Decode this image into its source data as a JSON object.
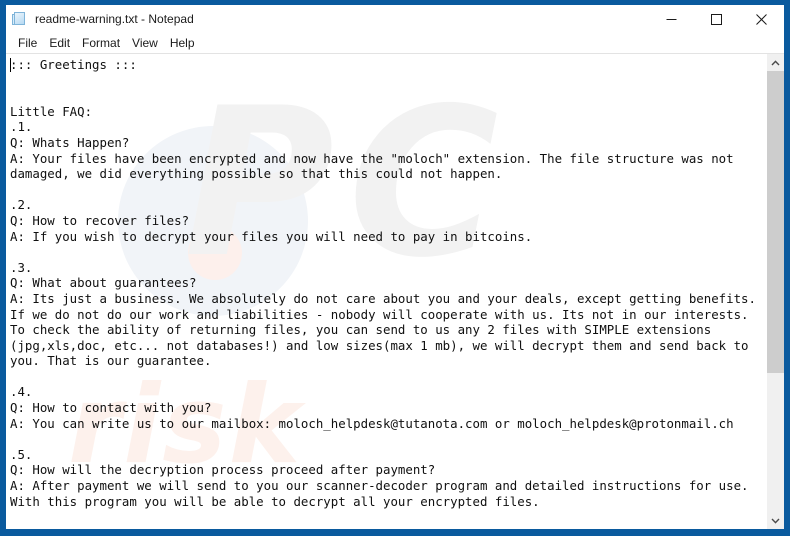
{
  "window": {
    "title": "readme-warning.txt - Notepad",
    "icon": "notepad-icon",
    "border_color": "#0a5a9e",
    "controls": {
      "minimize": "minimize-icon",
      "maximize": "maximize-icon",
      "close": "close-icon"
    }
  },
  "menubar": {
    "items": [
      {
        "label": "File"
      },
      {
        "label": "Edit"
      },
      {
        "label": "Format"
      },
      {
        "label": "View"
      },
      {
        "label": "Help"
      }
    ]
  },
  "editor": {
    "content": "::: Greetings :::\n\n\nLittle FAQ:\n.1.\nQ: Whats Happen?\nA: Your files have been encrypted and now have the \"moloch\" extension. The file structure was not\ndamaged, we did everything possible so that this could not happen.\n\n.2.\nQ: How to recover files?\nA: If you wish to decrypt your files you will need to pay in bitcoins.\n\n.3.\nQ: What about guarantees?\nA: Its just a business. We absolutely do not care about you and your deals, except getting benefits.\nIf we do not do our work and liabilities - nobody will cooperate with us. Its not in our interests.\nTo check the ability of returning files, you can send to us any 2 files with SIMPLE extensions\n(jpg,xls,doc, etc... not databases!) and low sizes(max 1 mb), we will decrypt them and send back to\nyou. That is our guarantee.\n\n.4.\nQ: How to contact with you?\nA: You can write us to our mailbox: moloch_helpdesk@tutanota.com or moloch_helpdesk@protonmail.ch\n\n.5.\nQ: How will the decryption process proceed after payment?\nA: After payment we will send to you our scanner-decoder program and detailed instructions for use.\nWith this program you will be able to decrypt all your encrypted files.",
    "ransomware_extension": "moloch",
    "contact_emails": [
      "moloch_helpdesk@tutanota.com",
      "moloch_helpdesk@protonmail.ch"
    ],
    "watermark": {
      "primary": "PC",
      "secondary": "risk"
    }
  },
  "scrollbar": {
    "up_arrow": "chevron-up-icon",
    "down_arrow": "chevron-down-icon",
    "thumb_position_percent": 0,
    "thumb_size_percent": 68.5
  }
}
